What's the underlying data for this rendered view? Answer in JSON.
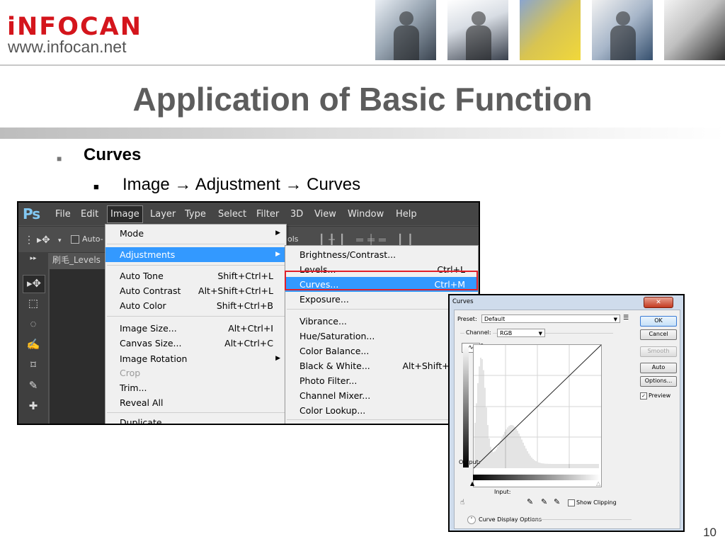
{
  "slide": {
    "logo_text": "iNFOCAN",
    "logo_url": "www.infocan.net",
    "title": "Application of Basic Function",
    "bullet_l1": "Curves",
    "bullet_l2": "Image → Adjustment → Curves",
    "page_number": "10",
    "bullet_symbol": "■",
    "colors": {
      "logo": "#d4151c",
      "title": "#5d5d5d",
      "highlight": "#3399ff",
      "callout": "#e0202a"
    }
  },
  "photoshop": {
    "logo": "Ps",
    "menubar": [
      "File",
      "Edit",
      "Image",
      "Layer",
      "Type",
      "Select",
      "Filter",
      "3D",
      "View",
      "Window",
      "Help"
    ],
    "active_menu": "Image",
    "options_bar": {
      "auto_select": "Auto-",
      "tools_label": "ols"
    },
    "doc_tab": "刷毛_Levels",
    "tool_icons": [
      "move-icon",
      "marquee-icon",
      "lasso-icon",
      "quick-select-icon",
      "crop-icon",
      "eyedropper-icon",
      "healing-brush-icon"
    ],
    "image_menu": [
      {
        "label": "Mode",
        "shortcut": "",
        "submenu": true
      },
      {
        "label": "Adjustments",
        "shortcut": "",
        "submenu": true,
        "highlighted": true
      },
      {
        "label": "Auto Tone",
        "shortcut": "Shift+Ctrl+L"
      },
      {
        "label": "Auto Contrast",
        "shortcut": "Alt+Shift+Ctrl+L"
      },
      {
        "label": "Auto Color",
        "shortcut": "Shift+Ctrl+B"
      },
      {
        "label": "Image Size...",
        "shortcut": "Alt+Ctrl+I"
      },
      {
        "label": "Canvas Size...",
        "shortcut": "Alt+Ctrl+C"
      },
      {
        "label": "Image Rotation",
        "shortcut": "",
        "submenu": true
      },
      {
        "label": "Crop",
        "shortcut": "",
        "disabled": true
      },
      {
        "label": "Trim...",
        "shortcut": ""
      },
      {
        "label": "Reveal All",
        "shortcut": ""
      },
      {
        "label": "Duplicate...",
        "shortcut": ""
      }
    ],
    "adjustments_menu": [
      {
        "label": "Brightness/Contrast...",
        "shortcut": ""
      },
      {
        "label": "Levels...",
        "shortcut": "Ctrl+L"
      },
      {
        "label": "Curves...",
        "shortcut": "Ctrl+M",
        "highlighted": true
      },
      {
        "label": "Exposure...",
        "shortcut": ""
      },
      {
        "label": "Vibrance...",
        "shortcut": ""
      },
      {
        "label": "Hue/Saturation...",
        "shortcut": "Ctrl"
      },
      {
        "label": "Color Balance...",
        "shortcut": "Ctrl"
      },
      {
        "label": "Black & White...",
        "shortcut": "Alt+Shift+Ctrl"
      },
      {
        "label": "Photo Filter...",
        "shortcut": ""
      },
      {
        "label": "Channel Mixer...",
        "shortcut": ""
      },
      {
        "label": "Color Lookup...",
        "shortcut": ""
      }
    ]
  },
  "curves_dialog": {
    "title": "Curves",
    "preset_label": "Preset:",
    "preset_value": "Default",
    "channel_label": "Channel:",
    "channel_value": "RGB",
    "output_label": "Output:",
    "input_label": "Input:",
    "show_clipping_label": "Show Clipping",
    "show_clipping_checked": false,
    "display_options_label": "Curve Display Options",
    "buttons": {
      "ok": "OK",
      "cancel": "Cancel",
      "smooth": "Smooth",
      "auto": "Auto",
      "options": "Options..."
    },
    "preview_label": "Preview",
    "preview_checked": true
  }
}
